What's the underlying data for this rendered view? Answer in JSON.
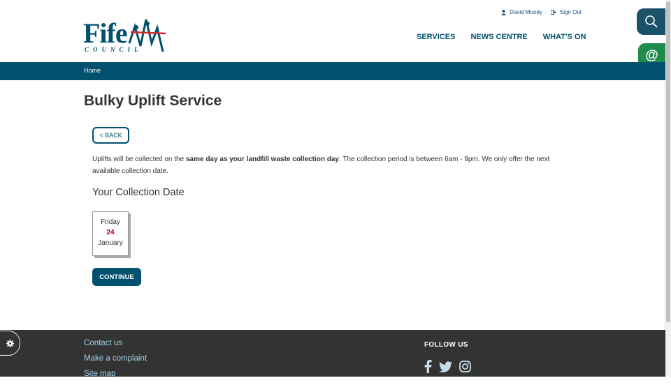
{
  "header": {
    "logo": {
      "word": "Fife",
      "subtitle": "COUNCIL"
    },
    "user": {
      "name": "David Moody",
      "sign_out": "Sign Out"
    },
    "nav": [
      {
        "label": "SERVICES"
      },
      {
        "label": "NEWS CENTRE"
      },
      {
        "label": "WHAT'S ON"
      }
    ],
    "side_email_icon": "@"
  },
  "breadcrumb": {
    "home": "Home"
  },
  "main": {
    "title": "Bulky Uplift Service",
    "back_label": "< BACK",
    "info": {
      "part1": "Uplifts will be collected on the ",
      "bold": "same day as your landfill waste collection day",
      "part2": ". The collection period is between 6am - 9pm. We only offer the next available collection date."
    },
    "collection_heading": "Your Collection Date",
    "date": {
      "day": "Friday",
      "number": "24",
      "month": "January"
    },
    "continue_label": "CONTINUE"
  },
  "footer": {
    "links": [
      "Contact us",
      "Make a complaint",
      "Site map"
    ],
    "follow_heading": "FOLLOW US",
    "social_icons": [
      "facebook-icon",
      "twitter-icon",
      "instagram-icon"
    ]
  },
  "colors": {
    "primary": "#00506e",
    "green": "#1f8c4d",
    "footer": "#333333",
    "link": "#9fd3ee",
    "date_accent": "#aa0000"
  }
}
